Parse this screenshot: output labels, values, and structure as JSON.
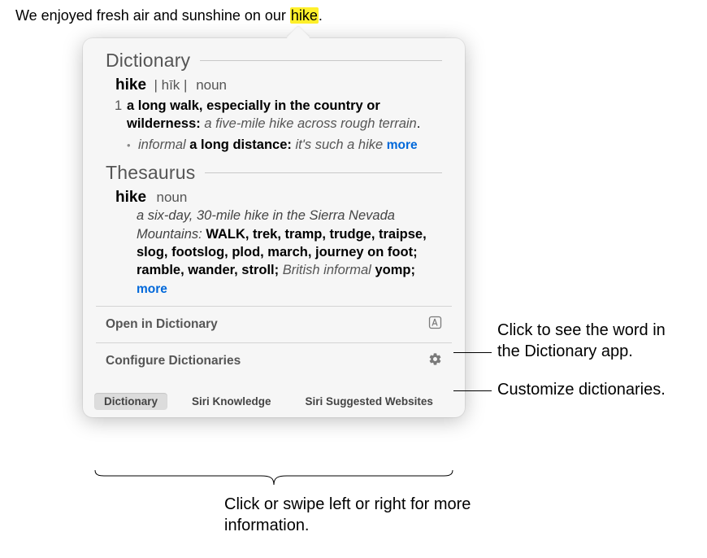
{
  "source_text": {
    "before": "We enjoyed fresh air and sunshine on our ",
    "highlight": "hike",
    "after": "."
  },
  "popover": {
    "dictionary": {
      "heading": "Dictionary",
      "word": "hike",
      "pron_open": "| ",
      "pron": "hīk",
      "pron_close": " |",
      "pos": "noun",
      "sense_num": "1",
      "def1": "a long walk, especially in the country or wilderness:",
      "ex1": " a five-mile hike across rough terrain",
      "dot1": ".",
      "sub_label": "informal ",
      "sub_def": "a long distance:",
      "sub_ex": " it's such a hike ",
      "more": "more"
    },
    "thesaurus": {
      "heading": "Thesaurus",
      "word": "hike",
      "pos": "noun",
      "example": "a six-day, 30-mile hike in the Sierra Nevada Mountains",
      "colon": ": ",
      "syn_lead": "WALK",
      "syns_rest": ", trek, tramp, trudge, traipse, slog, footslog, plod, march, journey on foot; ramble, wander, stroll; ",
      "label_brit": "British informal ",
      "syn_brit": "yomp; ",
      "more": "more"
    },
    "actions": {
      "open_label": "Open in Dictionary",
      "configure_label": "Configure Dictionaries"
    },
    "tabs": {
      "dictionary": "Dictionary",
      "siri_knowledge": "Siri Knowledge",
      "siri_sites": "Siri Suggested Websites"
    }
  },
  "callouts": {
    "open": "Click to see the word in the Dictionary app.",
    "configure": "Customize dictionaries.",
    "tabs": "Click or swipe left or right for more information."
  }
}
